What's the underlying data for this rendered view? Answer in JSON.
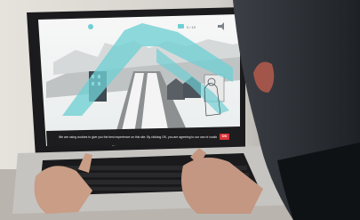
{
  "cookie_banner": {
    "message": "We are using cookies to give you the best experience on this site. By clicking OK, you are agreeing to our use of cookies.",
    "ok_label": "OK"
  },
  "header": {
    "score_readout": "0 / 10"
  },
  "icons": [
    "clock-icon",
    "score-icon",
    "sound-icon"
  ],
  "colors": {
    "accent_teal": "#6fcfd4",
    "cookie_bar": "#1d1d1f",
    "ok_button": "#d8353a"
  }
}
